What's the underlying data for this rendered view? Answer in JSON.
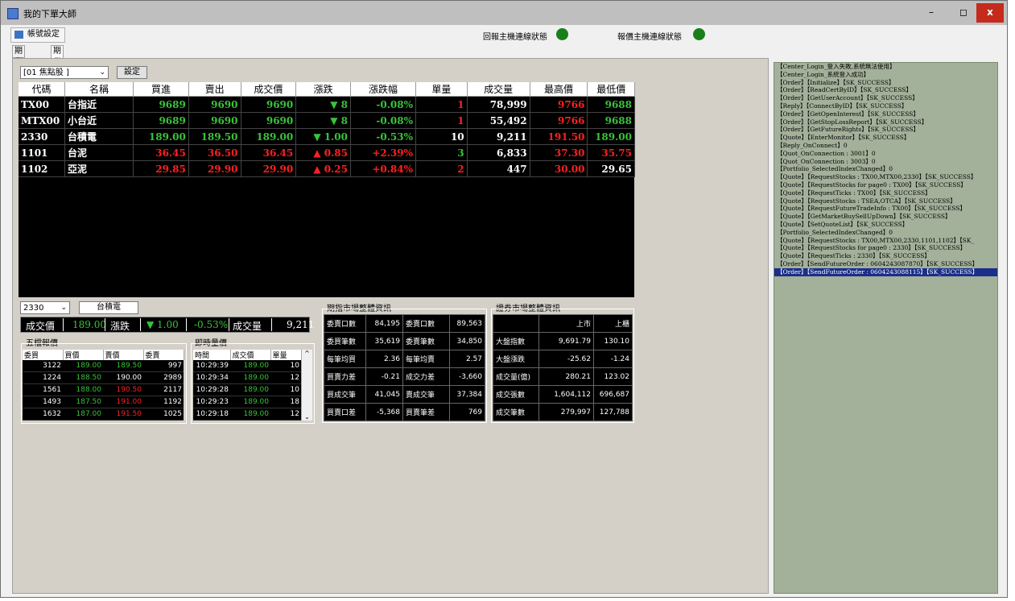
{
  "window": {
    "title": "我的下單大師",
    "controls": {
      "minimize": "–",
      "maximize": "◻",
      "close": "x"
    }
  },
  "menu": {
    "account_settings": "帳號設定"
  },
  "status": {
    "reply_label": "回報主機連線狀態",
    "quote_label": "報價主機連線狀態",
    "reply_color": "#1a7f1a",
    "quote_color": "#1a7f1a"
  },
  "tabs": [
    {
      "label": "期貨下單"
    },
    {
      "label": "期貨報價"
    }
  ],
  "selector": {
    "group_value": "[01 焦點股 ]",
    "set_button": "設定"
  },
  "quote_table": {
    "headers": [
      "代碼",
      "名稱",
      "買進",
      "賣出",
      "成交價",
      "漲跌",
      "漲跌幅",
      "單量",
      "成交量",
      "最高價",
      "最低價"
    ],
    "rows": [
      {
        "code": "TX00",
        "name": "台指近",
        "bid": "9689",
        "ask": "9690",
        "last": "9690",
        "chg": "▼ 8",
        "pct": "-0.08%",
        "qty": "1",
        "vol": "78,999",
        "high": "9766",
        "low": "9688",
        "dir": "down"
      },
      {
        "code": "MTX00",
        "name": "小台近",
        "bid": "9689",
        "ask": "9690",
        "last": "9690",
        "chg": "▼ 8",
        "pct": "-0.08%",
        "qty": "1",
        "vol": "55,492",
        "high": "9766",
        "low": "9688",
        "dir": "down"
      },
      {
        "code": "2330",
        "name": "台積電",
        "bid": "189.00",
        "ask": "189.50",
        "last": "189.00",
        "chg": "▼ 1.00",
        "pct": "-0.53%",
        "qty": "10",
        "vol": "9,211",
        "high": "191.50",
        "low": "189.00",
        "dir": "down"
      },
      {
        "code": "1101",
        "name": "台泥",
        "bid": "36.45",
        "ask": "36.50",
        "last": "36.45",
        "chg": "▲ 0.85",
        "pct": "+2.39%",
        "qty": "3",
        "vol": "6,833",
        "high": "37.30",
        "low": "35.75",
        "dir": "up"
      },
      {
        "code": "1102",
        "name": "亞泥",
        "bid": "29.85",
        "ask": "29.90",
        "last": "29.90",
        "chg": "▲ 0.25",
        "pct": "+0.84%",
        "qty": "2",
        "vol": "447",
        "high": "30.00",
        "low": "29.65",
        "dir": "up"
      }
    ]
  },
  "stock_detail": {
    "code_value": "2330",
    "name_button": "台積電",
    "last_label": "成交價",
    "last_value": "189.00",
    "chg_label": "漲跌",
    "chg_value": "▼ 1.00",
    "pct_value": "-0.53%",
    "vol_label": "成交量",
    "vol_value": "9,211"
  },
  "five_level": {
    "title": "五檔報價",
    "headers": [
      "委買",
      "買價",
      "賣價",
      "委賣"
    ],
    "rows": [
      [
        "3122",
        "189.00",
        "189.50",
        "997"
      ],
      [
        "1224",
        "188.50",
        "190.00",
        "2989"
      ],
      [
        "1561",
        "188.00",
        "190.50",
        "2117"
      ],
      [
        "1493",
        "187.50",
        "191.00",
        "1192"
      ],
      [
        "1632",
        "187.00",
        "191.50",
        "1025"
      ]
    ]
  },
  "ticks": {
    "title": "即時量價",
    "headers": [
      "時間",
      "成交價",
      "單量"
    ],
    "rows": [
      [
        "10:29:39",
        "189.00",
        "10"
      ],
      [
        "10:29:34",
        "189.00",
        "12"
      ],
      [
        "10:29:28",
        "189.00",
        "10"
      ],
      [
        "10:29:23",
        "189.00",
        "18"
      ],
      [
        "10:29:18",
        "189.00",
        "12"
      ]
    ]
  },
  "futures_market": {
    "title": "期指市場整體資訊",
    "rows": [
      [
        "委賣口數",
        "84,195",
        "委賣口數",
        "89,563"
      ],
      [
        "委買筆數",
        "35,619",
        "委賣筆數",
        "34,850"
      ],
      [
        "每筆均買",
        "2.36",
        "每筆均賣",
        "2.57"
      ],
      [
        "買賣力差",
        "-0.21",
        "成交力差",
        "-3,660"
      ],
      [
        "買成交筆",
        "41,045",
        "賣成交筆",
        "37,384"
      ],
      [
        "買賣口差",
        "-5,368",
        "買賣筆差",
        "769"
      ]
    ]
  },
  "stock_market": {
    "title": "證券市場整體資訊",
    "headers": [
      "",
      "上市",
      "上櫃"
    ],
    "rows": [
      [
        "大盤指數",
        "9,691.79",
        "130.10"
      ],
      [
        "大盤漲跌",
        "-25.62",
        "-1.24"
      ],
      [
        "成交量(億)",
        "280.21",
        "123.02"
      ],
      [
        "成交張數",
        "1,604,112",
        "696,687"
      ],
      [
        "成交筆數",
        "279,997",
        "127,788"
      ]
    ]
  },
  "log": [
    "【Center_Login_登入失敗,系統無法使用】",
    "【Center_Login_系統登入成功】",
    "【Order】【Initialize】【SK_SUCCESS】",
    "【Order】【ReadCertByID】【SK_SUCCESS】",
    "【Order】【GetUserAccount】【SK_SUCCESS】",
    "【Reply】【ConnectByID】【SK_SUCCESS】",
    "【Order】【GetOpenInterest】【SK_SUCCESS】",
    "【Order】【GetStopLossReport】【SK_SUCCESS】",
    "【Order】【GetFutureRights】【SK_SUCCESS】",
    "【Quote】【EnterMonitor】【SK_SUCCESS】",
    "【Reply_OnConnect】0",
    "【Quot_OnConnection : 3001】0",
    "【Quot_OnConnection : 3003】0",
    "【Portfolio_SelectedIndexChanged】0",
    "【Quote】【RequestStocks : TX00,MTX00,2330】【SK_SUCCESS】",
    "【Quote】【RequestStocks for page0 : TX00】【SK_SUCCESS】",
    "【Quote】【RequestTicks : TX00】【SK_SUCCESS】",
    "【Quote】【RequestStocks : TSEA,OTCA】【SK_SUCCESS】",
    "【Quote】【RequestFutureTradeInfo : TX00】【SK_SUCCESS】",
    "【Quote】【GetMarketBuySellUpDown】【SK_SUCCESS】",
    "【Quote】【SetQuoteList】【SK_SUCCESS】",
    "【Portfolio_SelectedIndexChanged】0",
    "【Quote】【RequestStocks : TX00,MTX00,2330,1101,1102】【SK_",
    "【Quote】【RequestStocks for page0 : 2330】【SK_SUCCESS】",
    "【Quote】【RequestTicks : 2330】【SK_SUCCESS】",
    "【Order】【SendFutureOrder : 0604243087870】【SK_SUCCESS】",
    "【Order】【SendFutureOrder : 0604243088115】【SK_SUCCESS】"
  ]
}
